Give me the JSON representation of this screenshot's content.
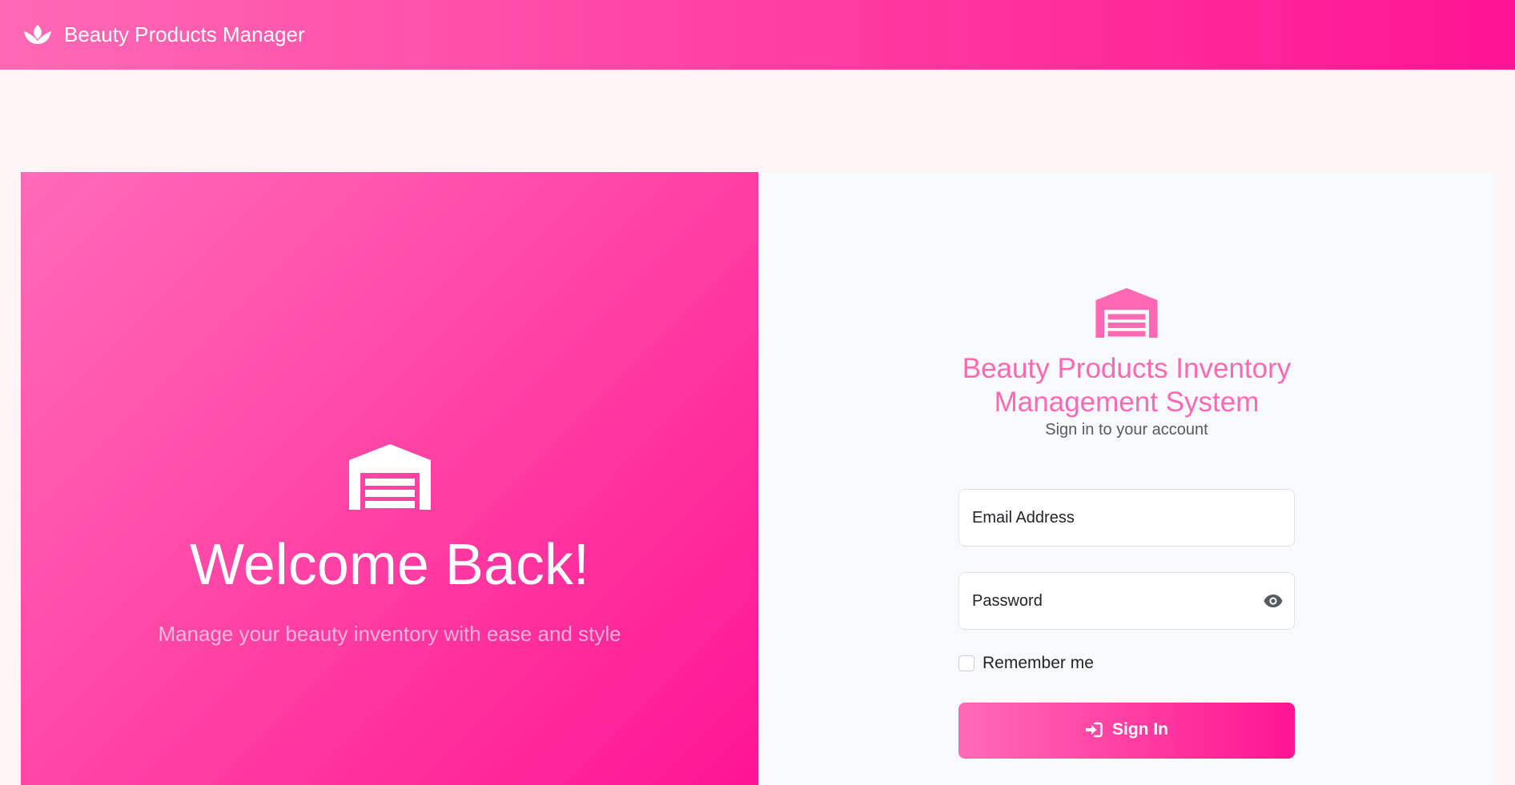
{
  "navbar": {
    "brand_label": "Beauty Products Manager",
    "brand_icon": "spa-lotus-icon"
  },
  "left_panel": {
    "icon": "warehouse-icon",
    "title": "Welcome Back!",
    "subtitle": "Manage your beauty inventory with ease and style"
  },
  "login": {
    "icon": "warehouse-icon",
    "title": "Beauty Products Inventory Management System",
    "subtitle": "Sign in to your account",
    "email_label": "Email Address",
    "password_label": "Password",
    "password_toggle_icon": "eye-icon",
    "remember_label": "Remember me",
    "submit_label": "Sign In",
    "submit_icon": "sign-in-icon"
  },
  "colors": {
    "accent": "#ff69b4",
    "accent_dark": "#ff1493",
    "page_bg": "#fff5f7",
    "form_bg": "#f8f9fb"
  }
}
